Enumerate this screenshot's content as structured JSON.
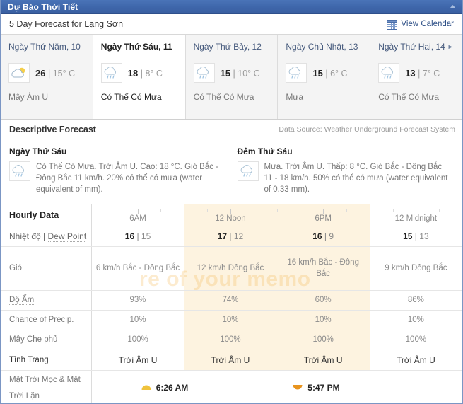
{
  "window": {
    "title": "Dự Báo Thời Tiết",
    "collapse_icon": "chevron-up-icon",
    "accent_color": "#3f67ab"
  },
  "subheader": {
    "title": "5 Day Forecast for Lạng Sơn",
    "view_calendar_label": "View Calendar",
    "calendar_icon": "calendar-icon"
  },
  "days": [
    {
      "name": "Ngày Thứ Năm, 10",
      "icon": "partly-cloudy-icon",
      "high": "26",
      "sep": "|",
      "low": "15° C",
      "condition": "Mây Âm U",
      "active": false
    },
    {
      "name": "Ngày Thứ Sáu, 11",
      "icon": "rain-icon",
      "high": "18",
      "sep": "|",
      "low": "8° C",
      "condition": "Có Thể Có Mưa",
      "active": true
    },
    {
      "name": "Ngày Thứ Bảy, 12",
      "icon": "rain-icon",
      "high": "15",
      "sep": "|",
      "low": "10° C",
      "condition": "Có Thể Có Mưa",
      "active": false
    },
    {
      "name": "Ngày Chủ Nhật, 13",
      "icon": "rain-icon",
      "high": "15",
      "sep": "|",
      "low": "6° C",
      "condition": "Mưa",
      "active": false
    },
    {
      "name": "Ngày Thứ Hai, 14",
      "next_arrow": "►",
      "icon": "rain-icon",
      "high": "13",
      "sep": "|",
      "low": "7° C",
      "condition": "Có Thể Có Mưa",
      "active": false
    }
  ],
  "descriptive": {
    "heading": "Descriptive Forecast",
    "source": "Data Source: Weather Underground Forecast System",
    "day": {
      "title": "Ngày Thứ Sáu",
      "icon": "rain-icon",
      "text": "Có Thể Có Mưa. Trời Âm U. Cao: 18 °C. Gió Bắc - Đông Bắc 11 km/h. 20% có thể có mưa (water equivalent of mm)."
    },
    "night": {
      "title": "Đêm Thứ Sáu",
      "icon": "rain-icon",
      "text": "Mưa. Trời Âm U. Thấp: 8 °C. Gió Bắc - Đông Bắc 11 - 18 km/h. 50% có thể có mưa (water equivalent of 0.33 mm)."
    }
  },
  "hourly": {
    "title": "Hourly Data",
    "times": [
      "6AM",
      "12 Noon",
      "6PM",
      "12 Midnight"
    ],
    "rows": [
      {
        "label": "Nhiệt độ | Dew Point",
        "label_plain": "Nhiệt độ",
        "label_sep": " | ",
        "label_underlined": "Dew Point",
        "type": "temp",
        "values": [
          {
            "t": "16",
            "sep": " | ",
            "d": "15"
          },
          {
            "t": "17",
            "sep": " | ",
            "d": "12"
          },
          {
            "t": "16",
            "sep": " | ",
            "d": "9"
          },
          {
            "t": "15",
            "sep": " | ",
            "d": "13"
          }
        ]
      },
      {
        "label": "Gió",
        "type": "wind",
        "values": [
          "6 km/h Bắc - Đông Bắc",
          "12 km/h Đông Bắc",
          "16 km/h Bắc - Đông Bắc",
          "9 km/h Đông Bắc"
        ]
      },
      {
        "label": "Độ Ẩm",
        "type": "hum",
        "values": [
          "93%",
          "74%",
          "60%",
          "86%"
        ]
      },
      {
        "label": "Chance of Precip.",
        "type": "precip",
        "values": [
          "10%",
          "10%",
          "10%",
          "10%"
        ]
      },
      {
        "label": "Mây Che phủ",
        "type": "cloud",
        "values": [
          "100%",
          "100%",
          "100%",
          "100%"
        ]
      },
      {
        "label": "Tình Trạng",
        "type": "cond",
        "values": [
          "Trời Âm U",
          "Trời Âm U",
          "Trời Âm U",
          "Trời Âm U"
        ]
      }
    ],
    "sun_row": {
      "label_line1": "Mặt Trời Mọc & Mặt",
      "label_line2": "Trời Lặn",
      "sunrise_icon": "sunrise-icon",
      "sunrise": "6:26 AM",
      "sunset_icon": "sunset-icon",
      "sunset": "5:47 PM"
    }
  },
  "watermark": {
    "text": "re of your memo"
  }
}
